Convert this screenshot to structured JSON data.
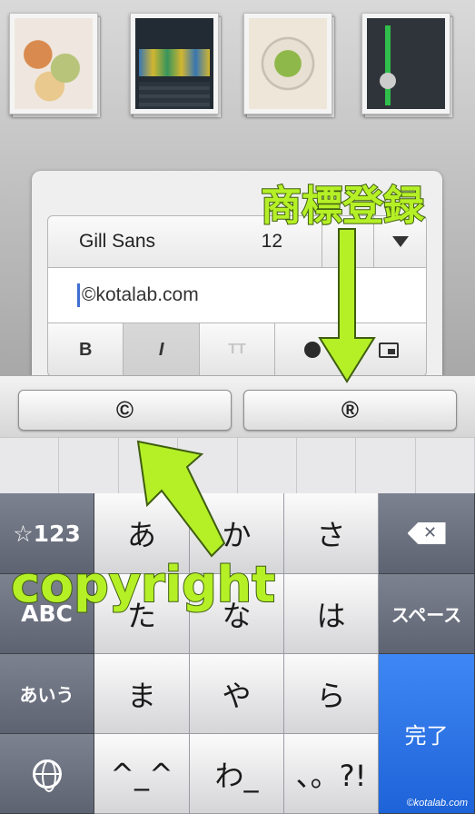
{
  "thumbnails": [
    {
      "name": "food-photo-1"
    },
    {
      "name": "sleep-chart"
    },
    {
      "name": "food-photo-2"
    },
    {
      "name": "transit-route"
    }
  ],
  "editor": {
    "font_name": "Gill Sans",
    "font_size": "12",
    "text_value": "©kotalab.com",
    "style_bold": "B",
    "style_italic": "I",
    "style_size": "TT"
  },
  "candidates": {
    "copyright": "©",
    "registered": "®"
  },
  "keyboard": {
    "numbers_key": "☆123",
    "abc_key": "ABC",
    "kana_mode_key": "あいう",
    "key_a": "あ",
    "key_ka": "か",
    "key_sa": "さ",
    "key_ta": "た",
    "key_na": "な",
    "key_ha": "は",
    "key_ma": "ま",
    "key_ya": "や",
    "key_ra": "ら",
    "key_emoticon": "^_^",
    "key_wa": "わ_",
    "key_punct": "、。?!",
    "space_key": "スペース",
    "done_key": "完了"
  },
  "annotations": {
    "trademark_label": "商標登録",
    "copyright_label": "copyright",
    "arrow_color": "#b5f027"
  },
  "watermark": "©kotalab.com"
}
